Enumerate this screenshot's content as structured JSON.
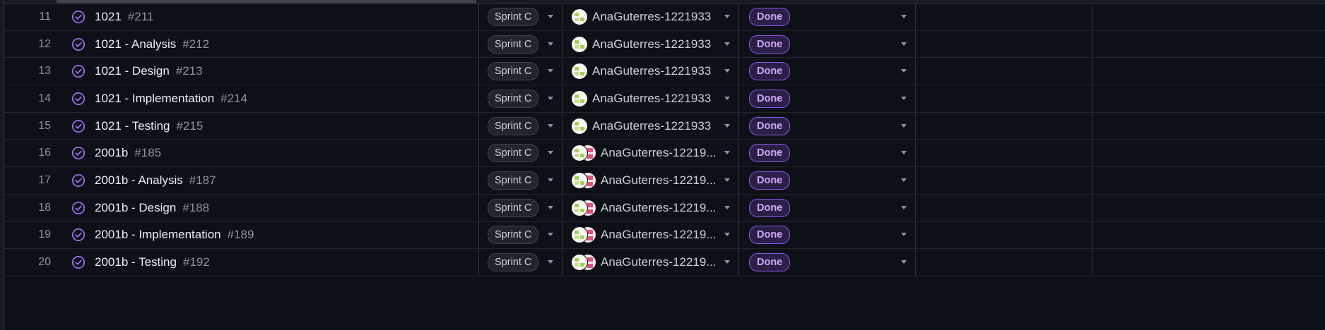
{
  "colors": {
    "background": "#0d1117",
    "done_purple": "#a371f7",
    "status_bg": "#2b1f47",
    "status_text": "#d2a8ff"
  },
  "rows": [
    {
      "num": "11",
      "title": "1021",
      "issue": "#211",
      "sprint": "Sprint C",
      "assignee": "AnaGuterres-1221933",
      "avatars": 1,
      "status": "Done"
    },
    {
      "num": "12",
      "title": "1021 - Analysis",
      "issue": "#212",
      "sprint": "Sprint C",
      "assignee": "AnaGuterres-1221933",
      "avatars": 1,
      "status": "Done"
    },
    {
      "num": "13",
      "title": "1021 - Design",
      "issue": "#213",
      "sprint": "Sprint C",
      "assignee": "AnaGuterres-1221933",
      "avatars": 1,
      "status": "Done"
    },
    {
      "num": "14",
      "title": "1021 - Implementation",
      "issue": "#214",
      "sprint": "Sprint C",
      "assignee": "AnaGuterres-1221933",
      "avatars": 1,
      "status": "Done"
    },
    {
      "num": "15",
      "title": "1021 - Testing",
      "issue": "#215",
      "sprint": "Sprint C",
      "assignee": "AnaGuterres-1221933",
      "avatars": 1,
      "status": "Done"
    },
    {
      "num": "16",
      "title": "2001b",
      "issue": "#185",
      "sprint": "Sprint C",
      "assignee": "AnaGuterres-12219...",
      "avatars": 2,
      "status": "Done"
    },
    {
      "num": "17",
      "title": "2001b - Analysis",
      "issue": "#187",
      "sprint": "Sprint C",
      "assignee": "AnaGuterres-12219...",
      "avatars": 2,
      "status": "Done"
    },
    {
      "num": "18",
      "title": "2001b - Design",
      "issue": "#188",
      "sprint": "Sprint C",
      "assignee": "AnaGuterres-12219...",
      "avatars": 2,
      "status": "Done"
    },
    {
      "num": "19",
      "title": "2001b - Implementation",
      "issue": "#189",
      "sprint": "Sprint C",
      "assignee": "AnaGuterres-12219...",
      "avatars": 2,
      "status": "Done"
    },
    {
      "num": "20",
      "title": "2001b - Testing",
      "issue": "#192",
      "sprint": "Sprint C",
      "assignee": "AnaGuterres-12219...",
      "avatars": 2,
      "status": "Done"
    }
  ]
}
